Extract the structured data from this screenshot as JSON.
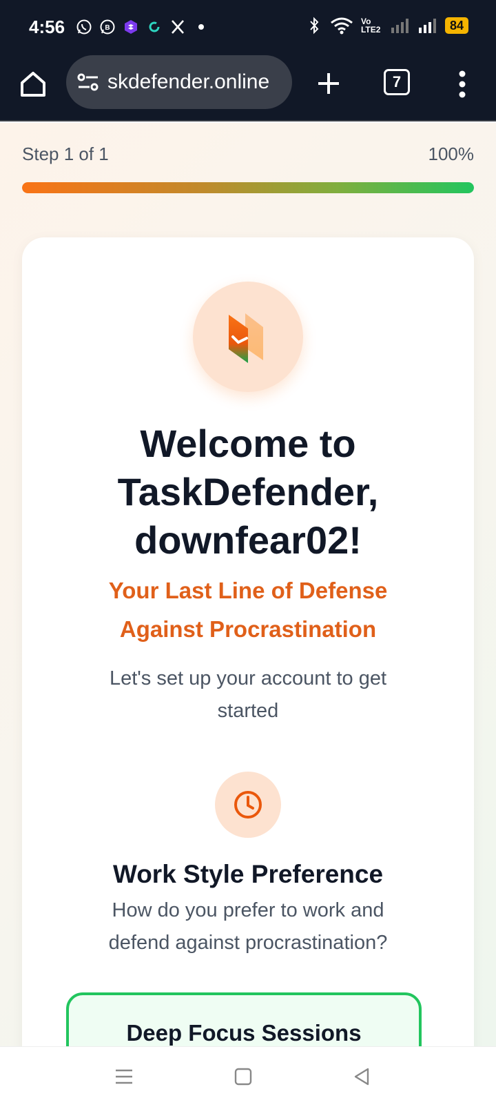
{
  "status_bar": {
    "time": "4:56",
    "battery": "84",
    "volte": "Vo LTE2",
    "left_icons": [
      "whatsapp-icon",
      "whatsapp-business-icon",
      "purple-app-icon",
      "green-sync-icon",
      "x-icon",
      "dot-icon"
    ],
    "right_icons": [
      "bluetooth-icon",
      "wifi-icon",
      "volte-icon",
      "signal-icon",
      "signal-icon",
      "battery-icon"
    ]
  },
  "browser": {
    "url": "skdefender.online",
    "tab_count": "7"
  },
  "progress": {
    "step_label": "Step 1 of 1",
    "percent_label": "100%",
    "value": 1.0
  },
  "card": {
    "welcome_line1": "Welcome to",
    "welcome_line2": "TaskDefender,",
    "welcome_line3": "downfear02!",
    "tagline_line1": "Your Last Line of Defense",
    "tagline_line2": "Against Procrastination",
    "subtitle_line1": "Let's set up your account to get",
    "subtitle_line2": "started",
    "section_title": "Work Style Preference",
    "section_desc_line1": "How do you prefer to work and",
    "section_desc_line2": "defend against procrastination?",
    "option_label": "Deep Focus Sessions"
  },
  "colors": {
    "accent": "#e0601a",
    "success": "#22c55e",
    "dark_bar": "#111827"
  }
}
